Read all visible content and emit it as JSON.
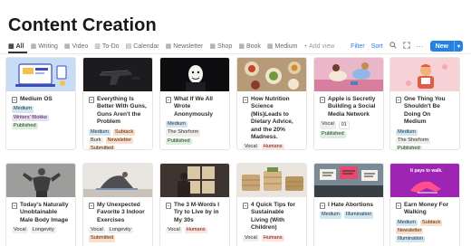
{
  "page": {
    "title": "Content Creation"
  },
  "tabs": [
    {
      "label": "All",
      "icon": "grid-icon",
      "glyph": "▦",
      "active": true
    },
    {
      "label": "Writing",
      "icon": "grid-icon",
      "glyph": "▦"
    },
    {
      "label": "Video",
      "icon": "grid-icon",
      "glyph": "▦"
    },
    {
      "label": "To-Do",
      "icon": "board-icon",
      "glyph": "▥"
    },
    {
      "label": "Calendar",
      "icon": "calendar-icon",
      "glyph": "▤"
    },
    {
      "label": "Newsletter",
      "icon": "grid-icon",
      "glyph": "▦"
    },
    {
      "label": "Shop",
      "icon": "grid-icon",
      "glyph": "▦"
    },
    {
      "label": "Book",
      "icon": "grid-icon",
      "glyph": "▦"
    },
    {
      "label": "Medium",
      "icon": "grid-icon",
      "glyph": "▦"
    }
  ],
  "add_view": "+ Add view",
  "toolbar": {
    "filter": "Filter",
    "sort": "Sort",
    "new": "New"
  },
  "tag_colors": {
    "Medium": {
      "bg": "#d3e5ef",
      "fg": "#183347"
    },
    "Vocal": {
      "bg": "#eeeeec",
      "fg": "#32302c"
    },
    "Writers' Blokke": {
      "bg": "#e8deee",
      "fg": "#412454"
    },
    "Published": {
      "bg": "#dbeddb",
      "fg": "#1c3829"
    },
    "Burk": {
      "bg": "#eeeeec",
      "fg": "#32302c"
    },
    "Newsletter": {
      "bg": "#fadec9",
      "fg": "#49290e"
    },
    "Submitted": {
      "bg": "#fadec9",
      "fg": "#49290e"
    },
    "The Shorform": {
      "bg": "#eeeeec",
      "fg": "#32302c"
    },
    "Humans": {
      "bg": "#ffe2dd",
      "fg": "#5d1715"
    },
    "01": {
      "bg": "#ffffff",
      "fg": "#32302c"
    },
    "Longevity": {
      "bg": "#eeeeec",
      "fg": "#32302c"
    },
    "Illumination": {
      "bg": "#d3e5ef",
      "fg": "#183347"
    },
    "Subtack": {
      "bg": "#fadec9",
      "fg": "#49290e"
    }
  },
  "cards": [
    {
      "title": "Medium OS",
      "thumb": "laptop-illustration",
      "tags": [
        "Medium",
        "Writers' Blokke"
      ],
      "status": "Published"
    },
    {
      "title": "Everything Is Better With Guns, Guns Aren't the Problem",
      "thumb": "handgun-photo",
      "tags": [
        "Medium",
        "Subtack",
        "Burk",
        "Newsletter"
      ],
      "status": "Submitted"
    },
    {
      "title": "What If We All Wrote Anonymously",
      "thumb": "masked-figure-photo",
      "tags": [
        "Medium",
        "The Shorform"
      ],
      "status": "Published"
    },
    {
      "title": "How Nutrition Science (Mis)Leads to Dietary Advice, and the 20% Madness.",
      "thumb": "food-spread-photo",
      "tags": [
        "Vocal",
        "Humans"
      ],
      "status": "Published"
    },
    {
      "title": "Apple is Secretly Building a Social Media Network",
      "thumb": "people-lounging-photo",
      "tags": [
        "Vocal",
        "01"
      ],
      "status": "Published"
    },
    {
      "title": "One Thing You Shouldn't Be Doing On Medium",
      "thumb": "pink-illustration",
      "tags": [
        "Medium",
        "The Shorform"
      ],
      "status": "Published"
    },
    {
      "title": "Today's Naturally Unobtainable Male Body Image",
      "thumb": "bodybuilder-photo",
      "tags": [
        "Vocal",
        "Longevity"
      ],
      "status": ""
    },
    {
      "title": "My Unexpected Favorite 3 Indoor Exercises",
      "thumb": "yoga-stretch-photo",
      "tags": [
        "Vocal",
        "Longevity"
      ],
      "status": "Submitted"
    },
    {
      "title": "The 3 M-Words I Try to Live by in My 30s",
      "thumb": "window-silhouette-photo",
      "tags": [
        "Vocal",
        "Humans"
      ],
      "status": ""
    },
    {
      "title": "4 Quick Tips for Sustainable Living (With Children)",
      "thumb": "wicker-baskets-photo",
      "tags": [
        "Vocal",
        "Humans"
      ],
      "status": ""
    },
    {
      "title": "I Hate Abortions",
      "thumb": "protest-signs-photo",
      "tags": [
        "Medium",
        "Illumination"
      ],
      "status": ""
    },
    {
      "title": "Earn Money For Walking",
      "thumb": "walking-illustration",
      "tags": [
        "Medium",
        "Subtack",
        "Newsletter",
        "Illumination"
      ],
      "status": ""
    }
  ]
}
